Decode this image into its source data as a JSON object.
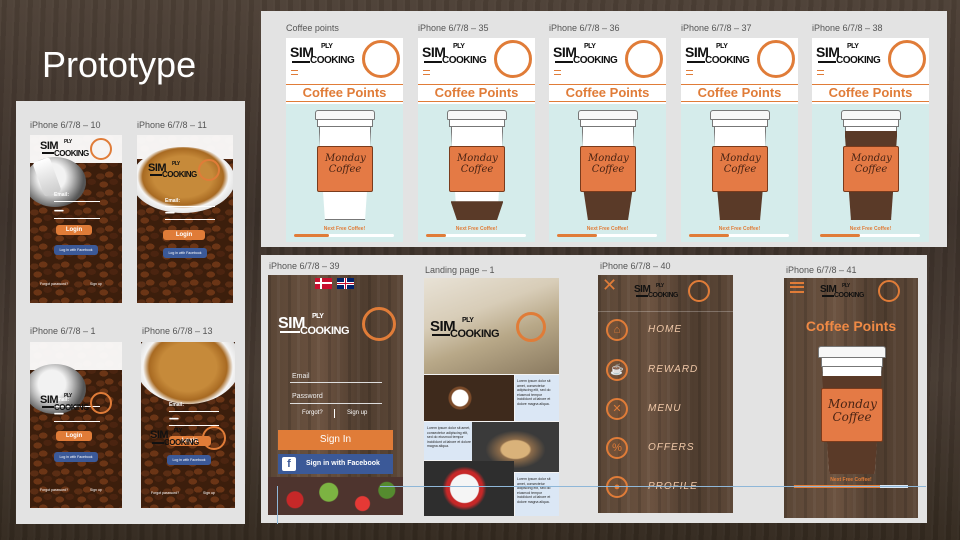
{
  "slide": {
    "title": "Prototype"
  },
  "logo": {
    "line1": "SIMPLY",
    "line2": "COOKING",
    "line1_small": "SIM",
    "line1_ply": "PLY",
    "line2_small": "COOKING"
  },
  "coffee_points_screens": [
    {
      "label": "Coffee points",
      "title": "Coffee Points",
      "sleeve": "Monday Coffee",
      "progress_label": "Next Free Coffee!",
      "fill_fraction": 0.0,
      "progress": 0.35
    },
    {
      "label": "iPhone 6/7/8 – 35",
      "title": "Coffee Points",
      "sleeve": "Monday Coffee",
      "progress_label": "Next Free Coffee!",
      "fill_fraction": 0.2,
      "progress": 0.2
    },
    {
      "label": "iPhone 6/7/8 – 36",
      "title": "Coffee Points",
      "sleeve": "Monday Coffee",
      "progress_label": "Next Free Coffee!",
      "fill_fraction": 0.45,
      "progress": 0.4
    },
    {
      "label": "iPhone 6/7/8 – 37",
      "title": "Coffee Points",
      "sleeve": "Monday Coffee",
      "progress_label": "Next Free Coffee!",
      "fill_fraction": 0.75,
      "progress": 0.4
    },
    {
      "label": "iPhone 6/7/8 – 38",
      "title": "Coffee Points",
      "sleeve": "Monday Coffee",
      "progress_label": "Next Free Coffee!",
      "fill_fraction": 0.95,
      "progress": 0.4
    }
  ],
  "small_screens": [
    {
      "label": "iPhone 6/7/8 – 10",
      "email": "Email:",
      "password": "••••••••",
      "login": "Login",
      "fb": "Log in with Facebook",
      "forgot": "Forgot password?",
      "signup": "Sign up"
    },
    {
      "label": "iPhone 6/7/8 – 11",
      "email": "Email:",
      "password": "••••••••",
      "login": "Login",
      "fb": "Log in with Facebook",
      "forgot": "",
      "signup": ""
    },
    {
      "label": "iPhone 6/7/8 – 1",
      "email": "Email:",
      "password": "••••••••",
      "login": "Login",
      "fb": "Log in with Facebook",
      "forgot": "Forgot password?",
      "signup": "Sign up"
    },
    {
      "label": "iPhone 6/7/8 – 13",
      "email": "Email:",
      "password": "••••••••",
      "login": "Login",
      "fb": "Log in with Facebook",
      "forgot": "Forgot password?",
      "signup": "Sign up"
    }
  ],
  "login_screen": {
    "label": "iPhone 6/7/8 – 39",
    "email": "Email",
    "password": "Password",
    "forgot": "Forgot?",
    "signup": "Sign up",
    "sign_in": "Sign In",
    "facebook": "Sign in with Facebook"
  },
  "landing": {
    "label": "Landing page – 1",
    "lorem": "Lorem ipsum dolor sit amet, consectetur adipiscing elit, sed do eiusmod tempor incididunt ut labore et dolore magna aliqua."
  },
  "menu_screen": {
    "label": "iPhone 6/7/8 – 40",
    "items": [
      "HOME",
      "REWARD",
      "MENU",
      "OFFERS",
      "PROFILE"
    ],
    "icons": [
      "home-icon",
      "reward-icon",
      "menu-icon",
      "offers-icon",
      "profile-icon"
    ]
  },
  "points_screen": {
    "label": "iPhone 6/7/8 – 41",
    "title": "Coffee Points",
    "sleeve": "Monday Coffee",
    "progress_label": "Next Free Coffee!"
  },
  "colors": {
    "accent": "#e07c38",
    "facebook": "#3b5998",
    "mint": "#d5eceb"
  }
}
